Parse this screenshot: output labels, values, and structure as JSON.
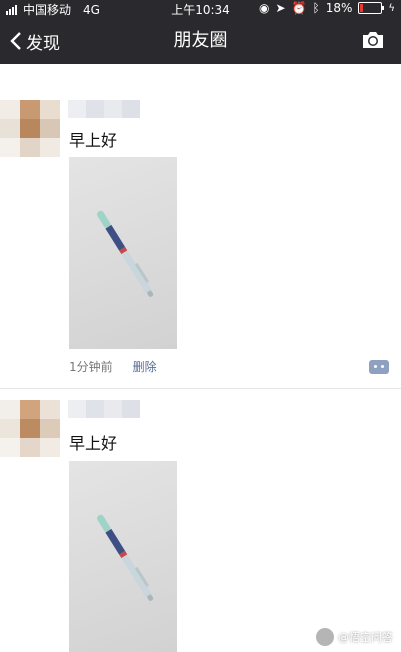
{
  "status": {
    "carrier": "中国移动",
    "network": "4G",
    "time": "上午10:34",
    "battery_pct": "18%"
  },
  "nav": {
    "back_label": "发现",
    "title": "朋友圈"
  },
  "posts": [
    {
      "text": "早上好",
      "time_ago": "1分钟前",
      "delete_label": "删除"
    },
    {
      "text": "早上好"
    }
  ],
  "colors": {
    "header_bg": "#2a2a2e",
    "link": "#576b95",
    "battery_low": "#e53935"
  },
  "watermark": "@悟空问答"
}
